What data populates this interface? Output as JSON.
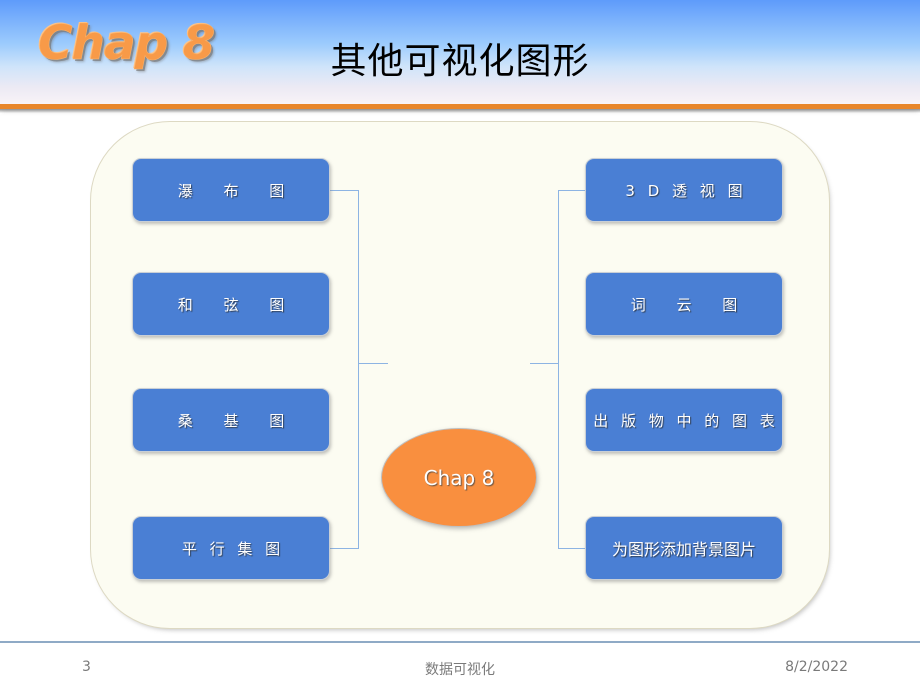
{
  "header": {
    "logo": "Chap 8",
    "title": "其他可视化图形",
    "gradient_top_color": "#5e9bfb",
    "gradient_bottom_color": "#f8f3f7",
    "rule_color": "#e8862a",
    "logo_color": "#f89a48"
  },
  "diagram": {
    "panel_fill": "#fcfcf2",
    "panel_border": "#ddd9c3",
    "connector_color": "#8db4e3",
    "node_fill": "#4a7fd4",
    "node_text_color": "#ffffff",
    "center": {
      "label": "Chap 8",
      "fill": "#f98f3f",
      "text_color": "#ffffff"
    },
    "left_nodes": [
      {
        "label": "瀑 布 图"
      },
      {
        "label": "和 弦 图"
      },
      {
        "label": "桑 基 图"
      },
      {
        "label": "平 行 集 图"
      }
    ],
    "right_nodes": [
      {
        "label": "3 D 透 视 图"
      },
      {
        "label": "词 云 图"
      },
      {
        "label": "出 版 物 中 的 图 表"
      },
      {
        "label": "为图形添加背景图片"
      }
    ]
  },
  "footer": {
    "page_number": "3",
    "center_text": "数据可视化",
    "date": "8/2/2022",
    "rule_color": "#8faac6"
  }
}
